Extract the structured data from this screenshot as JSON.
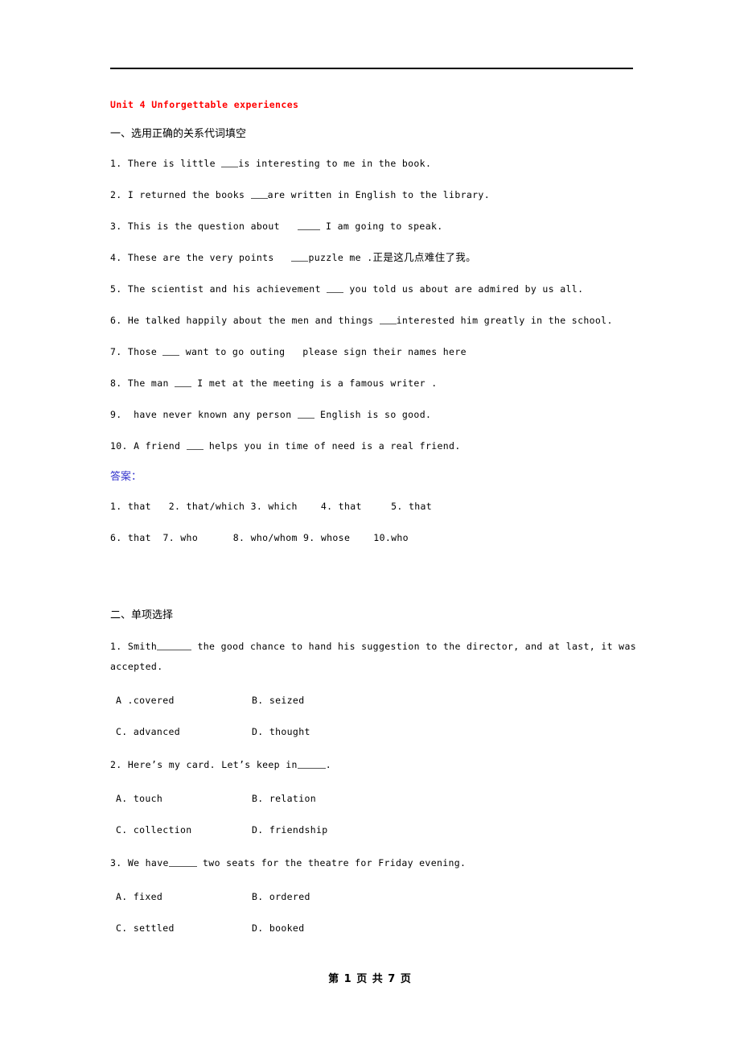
{
  "document": {
    "title": "Unit 4 Unforgettable experiences",
    "title_color": "#ff0000",
    "answer_heading_color": "#3333cc"
  },
  "section1": {
    "heading": "一、选用正确的关系代词填空",
    "questions": [
      {
        "pre": "1. There is little ",
        "blank": "b3",
        "post": "is interesting to me in the book."
      },
      {
        "pre": "2. I returned the books ",
        "blank": "b3",
        "post": "are written in English to the library."
      },
      {
        "pre": "3. This is the question about   ",
        "blank": "b4",
        "post": " I am going to speak."
      },
      {
        "pre": "4. These are the very points   ",
        "blank": "b3",
        "post": "puzzle me .",
        "cn": "正是这几点难住了我。"
      },
      {
        "pre": "5. The scientist and his achievement ",
        "blank": "b3",
        "post": " you told us about are admired by us all."
      },
      {
        "pre": "6. He talked happily about the men and things ",
        "blank": "b3",
        "post": "interested him greatly in the school."
      },
      {
        "pre": "7. Those ",
        "blank": "b3",
        "post": " want to go outing   please sign their names here"
      },
      {
        "pre": "8. The man ",
        "blank": "b3",
        "post": " I met at the meeting is a famous writer ."
      },
      {
        "pre": "9.  have never known any person ",
        "blank": "b3",
        "post": " English is so good."
      },
      {
        "pre": "10. A friend ",
        "blank": "b3",
        "post": " helps you in time of need is a real friend."
      }
    ],
    "answers_heading": "答案：",
    "answers_rows": [
      "1. that   2. that/which 3. which    4. that     5. that",
      "6. that  7. who      8. who/whom 9. whose    10.who"
    ]
  },
  "section2": {
    "heading": "二、单项选择",
    "items": [
      {
        "stem_pre": "1. Smith",
        "stem_blank": "b6",
        "stem_post": " the good chance to hand his suggestion to the director, and at last, it was",
        "stem_cont": "accepted.",
        "options": [
          {
            "a": "A .covered",
            "b": "B. seized"
          },
          {
            "a": "C. advanced",
            "b": "D. thought"
          }
        ]
      },
      {
        "stem_pre": "2. Here’s my card. Let’s keep in",
        "stem_blank": "b5",
        "stem_post": ".",
        "stem_cont": "",
        "options": [
          {
            "a": "A. touch",
            "b": "B. relation"
          },
          {
            "a": "C. collection",
            "b": "D. friendship"
          }
        ]
      },
      {
        "stem_pre": "3. We have",
        "stem_blank": "b5",
        "stem_post": " two seats for the theatre for Friday evening.",
        "stem_cont": "",
        "options": [
          {
            "a": "A. fixed",
            "b": "B. ordered"
          },
          {
            "a": "C. settled",
            "b": "D. booked"
          }
        ]
      }
    ]
  },
  "footer": {
    "page_label": "第 1 页 共 7 页"
  }
}
